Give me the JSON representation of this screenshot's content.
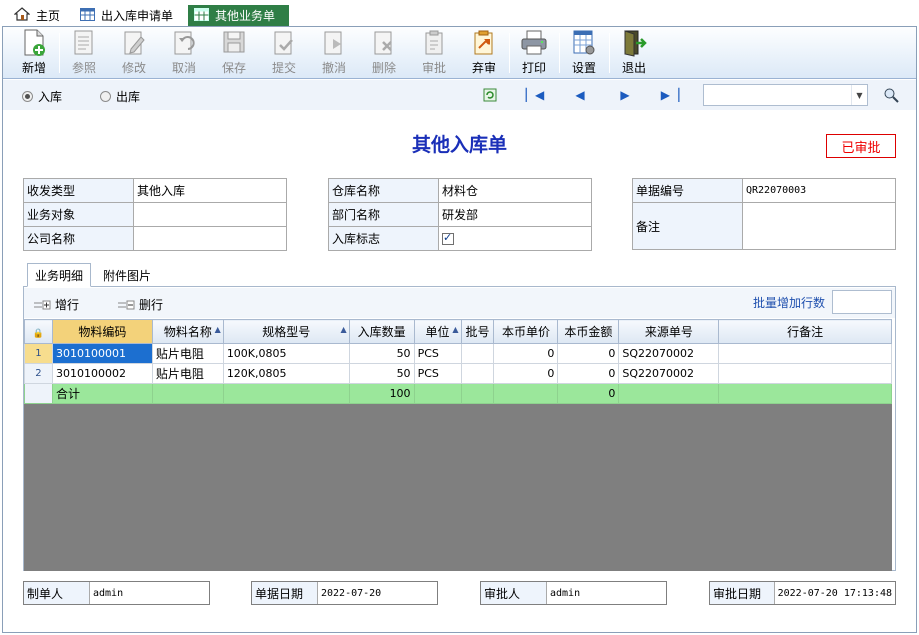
{
  "tabs": [
    {
      "label": "主页",
      "icon": "home-icon"
    },
    {
      "label": "出入库申请单",
      "icon": "grid-icon"
    },
    {
      "label": "其他业务单",
      "icon": "grid-icon",
      "active": true
    }
  ],
  "toolbar": {
    "add": "新增",
    "ref": "参照",
    "edit": "修改",
    "cancel": "取消",
    "save": "保存",
    "submit": "提交",
    "revoke": "撤消",
    "delete": "删除",
    "approve": "审批",
    "unapprove": "弃审",
    "print": "打印",
    "settings": "设置",
    "exit": "退出"
  },
  "nav": {
    "radio_in": "入库",
    "radio_out": "出库",
    "selected": "入库"
  },
  "doc": {
    "title": "其他入库单",
    "status": "已审批"
  },
  "form": {
    "type_label": "收发类型",
    "type_value": "其他入库",
    "target_label": "业务对象",
    "target_value": "",
    "company_label": "公司名称",
    "company_value": "",
    "warehouse_label": "仓库名称",
    "warehouse_value": "材料仓",
    "dept_label": "部门名称",
    "dept_value": "研发部",
    "inflag_label": "入库标志",
    "inflag_checked": true,
    "docno_label": "单据编号",
    "docno_value": "QR22070003",
    "remark_label": "备注",
    "remark_value": ""
  },
  "subtabs": {
    "detail": "业务明细",
    "attach": "附件图片"
  },
  "gridtool": {
    "add_row": "增行",
    "del_row": "删行",
    "batch_label": "批量增加行数"
  },
  "grid": {
    "columns": [
      "物料编码",
      "物料名称",
      "规格型号",
      "入库数量",
      "单位",
      "批号",
      "本币单价",
      "本币金额",
      "来源单号",
      "行备注"
    ],
    "rows": [
      {
        "no": "1",
        "code": "3010100001",
        "name": "贴片电阻",
        "spec": "100K,0805",
        "qty": "50",
        "unit": "PCS",
        "batch": "",
        "price": "0",
        "amount": "0",
        "src": "SQ22070002",
        "note": ""
      },
      {
        "no": "2",
        "code": "3010100002",
        "name": "贴片电阻",
        "spec": "120K,0805",
        "qty": "50",
        "unit": "PCS",
        "batch": "",
        "price": "0",
        "amount": "0",
        "src": "SQ22070002",
        "note": ""
      }
    ],
    "total": {
      "label": "合计",
      "qty": "100",
      "amount": "0"
    }
  },
  "footer": {
    "maker_label": "制单人",
    "maker_value": "admin",
    "date_label": "单据日期",
    "date_value": "2022-07-20",
    "approver_label": "审批人",
    "approver_value": "admin",
    "approve_date_label": "审批日期",
    "approve_date_value": "2022-07-20 17:13:48"
  }
}
